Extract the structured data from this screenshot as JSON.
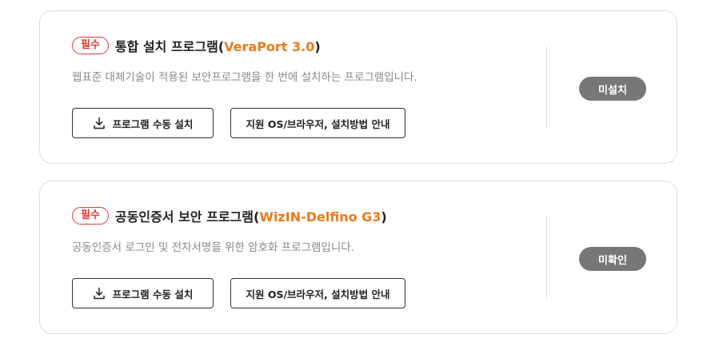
{
  "programs": [
    {
      "badge": "필수",
      "title_main": "통합 설치 프로그램(",
      "title_highlight": "VeraPort 3.0",
      "title_close": ")",
      "description": "웹표준 대체기술이 적용된 보안프로그램을 한 번에 설치하는 프로그램입니다.",
      "install_button": "프로그램 수동 설치",
      "guide_button": "지원 OS/브라우저, 설치방법 안내",
      "status": "미설치"
    },
    {
      "badge": "필수",
      "title_main": "공동인증서 보안 프로그램(",
      "title_highlight": "WizIN-Delfino G3",
      "title_close": ")",
      "description": "공동인증서 로그인 및 전자서명을 위한 암호화 프로그램입니다.",
      "install_button": "프로그램 수동 설치",
      "guide_button": "지원 OS/브라우저, 설치방법 안내",
      "status": "미확인"
    }
  ],
  "colors": {
    "badge_red": "#e03a2f",
    "highlight_orange": "#ee7a1a",
    "status_gray": "#777777"
  },
  "icons": {
    "install_button_icon": "download-icon"
  }
}
